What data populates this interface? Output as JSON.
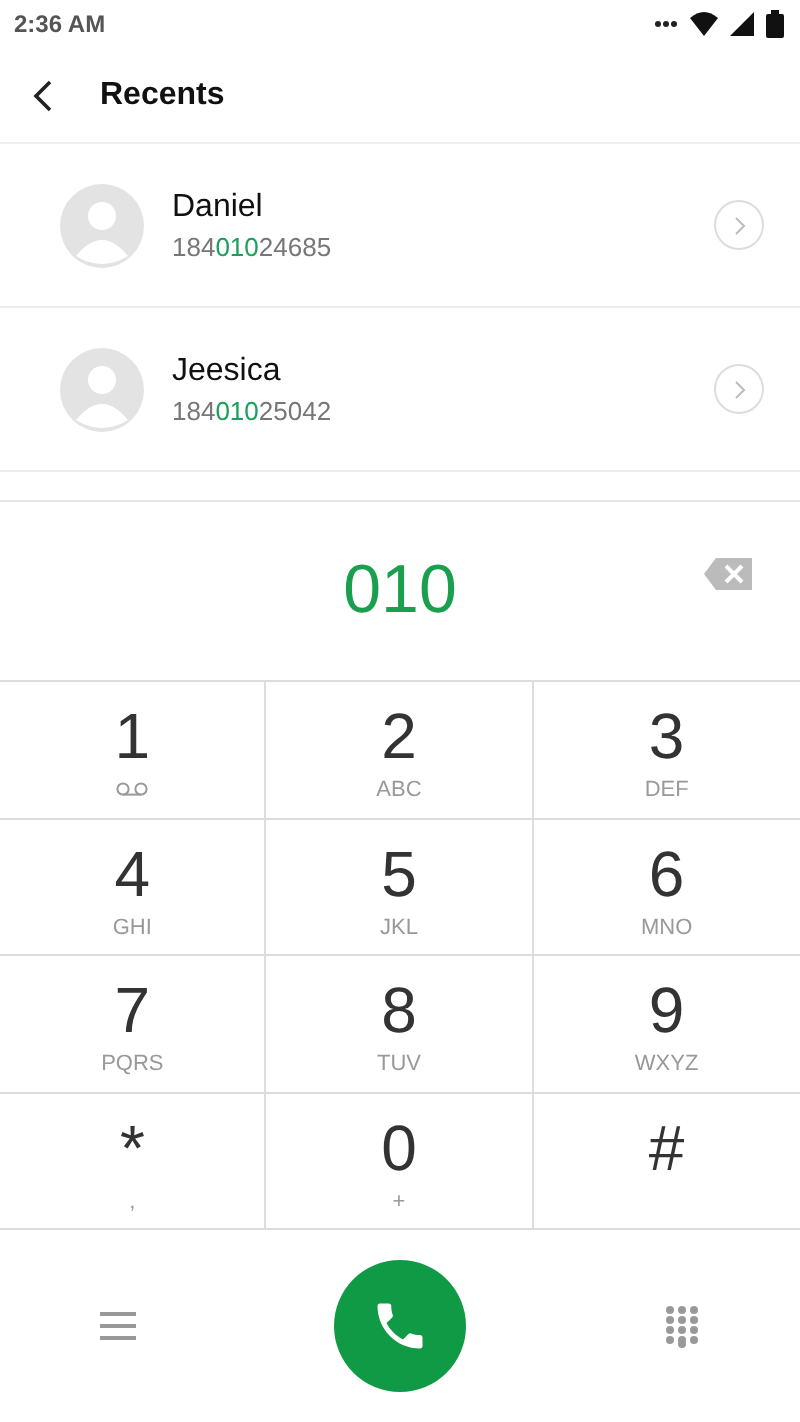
{
  "status_bar": {
    "time": "2:36 AM"
  },
  "header": {
    "title": "Recents"
  },
  "contacts": [
    {
      "name": "Daniel",
      "number": {
        "before": "184",
        "match": "010",
        "after": "24685"
      }
    },
    {
      "name": "Jeesica",
      "number": {
        "before": "184",
        "match": "010",
        "after": "25042"
      }
    }
  ],
  "dial": {
    "number": "010"
  },
  "keys": [
    {
      "digit": "1",
      "kind": "voicemail"
    },
    {
      "digit": "2",
      "kind": "letters",
      "sub": "ABC"
    },
    {
      "digit": "3",
      "kind": "letters",
      "sub": "DEF"
    },
    {
      "digit": "4",
      "kind": "letters",
      "sub": "GHI"
    },
    {
      "digit": "5",
      "kind": "letters",
      "sub": "JKL"
    },
    {
      "digit": "6",
      "kind": "letters",
      "sub": "MNO"
    },
    {
      "digit": "7",
      "kind": "letters",
      "sub": "PQRS"
    },
    {
      "digit": "8",
      "kind": "letters",
      "sub": "TUV"
    },
    {
      "digit": "9",
      "kind": "letters",
      "sub": "WXYZ"
    },
    {
      "digit": "*",
      "kind": "letters",
      "sub": ","
    },
    {
      "digit": "0",
      "kind": "letters",
      "sub": "+"
    },
    {
      "digit": "#",
      "kind": "plain"
    }
  ]
}
